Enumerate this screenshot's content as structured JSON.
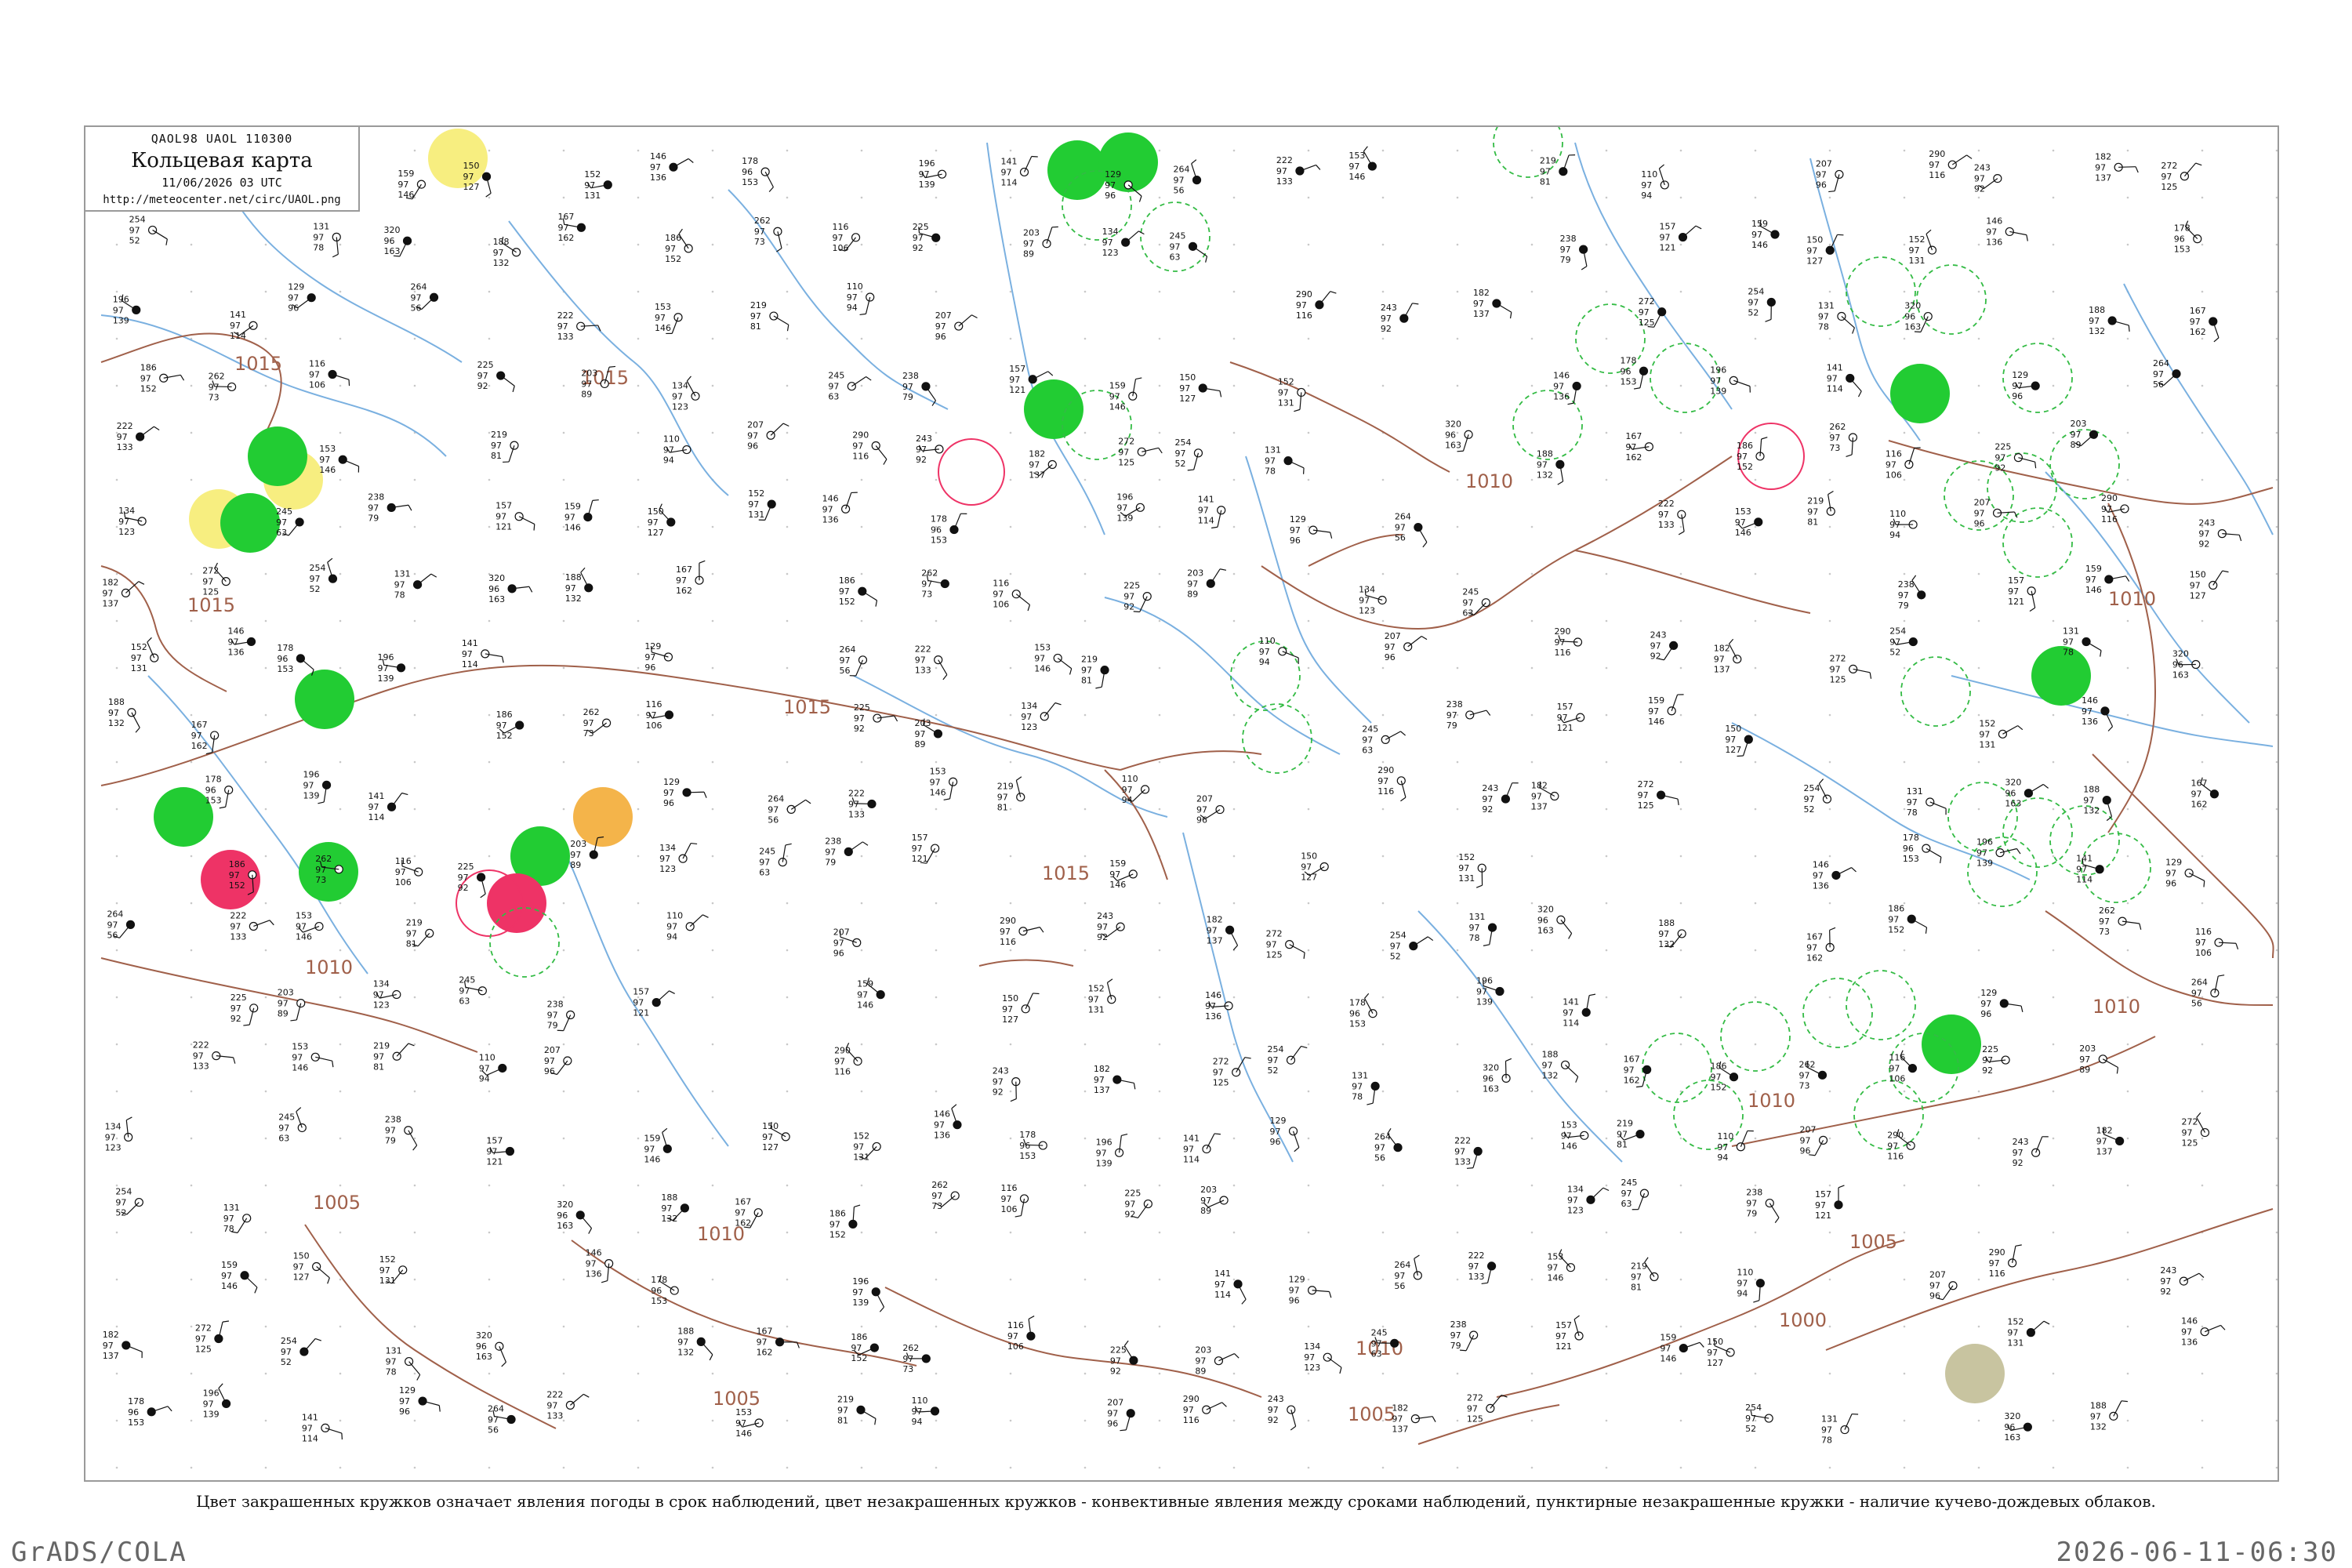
{
  "header": {
    "codes": "QAOL98  UAOL  110300",
    "title": "Кольцевая карта",
    "datetime": "11/06/2026 03 UTC",
    "url": "http://meteocenter.net/circ/UAOL.png"
  },
  "caption": "Цвет закрашенных кружков означает явления погоды в срок наблюдений, цвет незакрашенных кружков - конвективные явления между сроками наблюдений, пунктирные незакрашенные кружки - наличие кучево-дождевых облаков.",
  "footer": {
    "left": "GrADS/COLA",
    "right": "2026-06-11-06:30"
  },
  "colors": {
    "isobar": "#a0604a",
    "river": "#7ab0e0",
    "rain": "#22cc33",
    "thunder": "#ee3366",
    "haze": "#f7ee80",
    "dust": "#f4b44a",
    "fog": "#c8c4a0",
    "cb_dashed": "#33bb44"
  },
  "isobar_labels": [
    "1015",
    "1010",
    "1005",
    "1000"
  ],
  "stations": [
    {
      "p": "159",
      "t": "97",
      "d": "146"
    },
    {
      "p": "150",
      "t": "97",
      "d": "127"
    },
    {
      "p": "152",
      "t": "97",
      "d": "131"
    },
    {
      "p": "146",
      "t": "97",
      "d": "136"
    },
    {
      "p": "178",
      "t": "96",
      "d": "153"
    },
    {
      "p": "196",
      "t": "97",
      "d": "139"
    },
    {
      "p": "141",
      "t": "97",
      "d": "114"
    },
    {
      "p": "129",
      "t": "97",
      "d": "96"
    },
    {
      "p": "264",
      "t": "97",
      "d": "56"
    },
    {
      "p": "222",
      "t": "97",
      "d": "133"
    },
    {
      "p": "153",
      "t": "97",
      "d": "146"
    },
    {
      "p": "219",
      "t": "97",
      "d": "81"
    },
    {
      "p": "110",
      "t": "97",
      "d": "94"
    },
    {
      "p": "207",
      "t": "97",
      "d": "96"
    },
    {
      "p": "290",
      "t": "97",
      "d": "116"
    },
    {
      "p": "243",
      "t": "97",
      "d": "92"
    },
    {
      "p": "182",
      "t": "97",
      "d": "137"
    },
    {
      "p": "272",
      "t": "97",
      "d": "125"
    },
    {
      "p": "254",
      "t": "97",
      "d": "52"
    },
    {
      "p": "131",
      "t": "97",
      "d": "78"
    },
    {
      "p": "320",
      "t": "96",
      "d": "163"
    },
    {
      "p": "188",
      "t": "97",
      "d": "132"
    },
    {
      "p": "167",
      "t": "97",
      "d": "162"
    },
    {
      "p": "186",
      "t": "97",
      "d": "152"
    },
    {
      "p": "262",
      "t": "97",
      "d": "73"
    },
    {
      "p": "116",
      "t": "97",
      "d": "106"
    },
    {
      "p": "225",
      "t": "97",
      "d": "92"
    },
    {
      "p": "203",
      "t": "97",
      "d": "89"
    },
    {
      "p": "134",
      "t": "97",
      "d": "123"
    },
    {
      "p": "245",
      "t": "97",
      "d": "63"
    },
    {
      "p": "238",
      "t": "97",
      "d": "79"
    },
    {
      "p": "157",
      "t": "97",
      "d": "121"
    }
  ]
}
